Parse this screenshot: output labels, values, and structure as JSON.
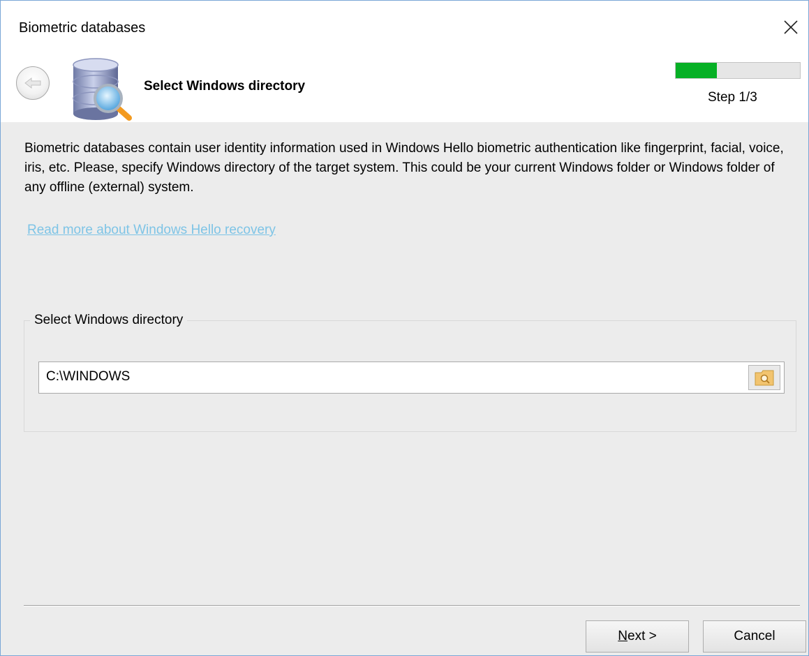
{
  "window": {
    "title": "Biometric databases"
  },
  "header": {
    "title": "Select Windows directory",
    "step": "Step 1/3",
    "progress": 0.33,
    "progress_color": "#06b025",
    "icon": "database-search-icon"
  },
  "body": {
    "description": "Biometric databases contain user identity information used in Windows Hello biometric authentication like fingerprint, facial, voice, iris, etc. Please, specify Windows directory of the target system. This could be your current Windows folder or Windows folder of any offline (external) system.",
    "link": "Read more about Windows Hello recovery",
    "link_color": "#7ec4e6"
  },
  "directory_group": {
    "label": "Select Windows directory",
    "value": "C:\\WINDOWS",
    "browse_icon": "folder-search-icon"
  },
  "buttons": {
    "next_prefix": "N",
    "next_rest": "ext >",
    "cancel": "Cancel"
  }
}
